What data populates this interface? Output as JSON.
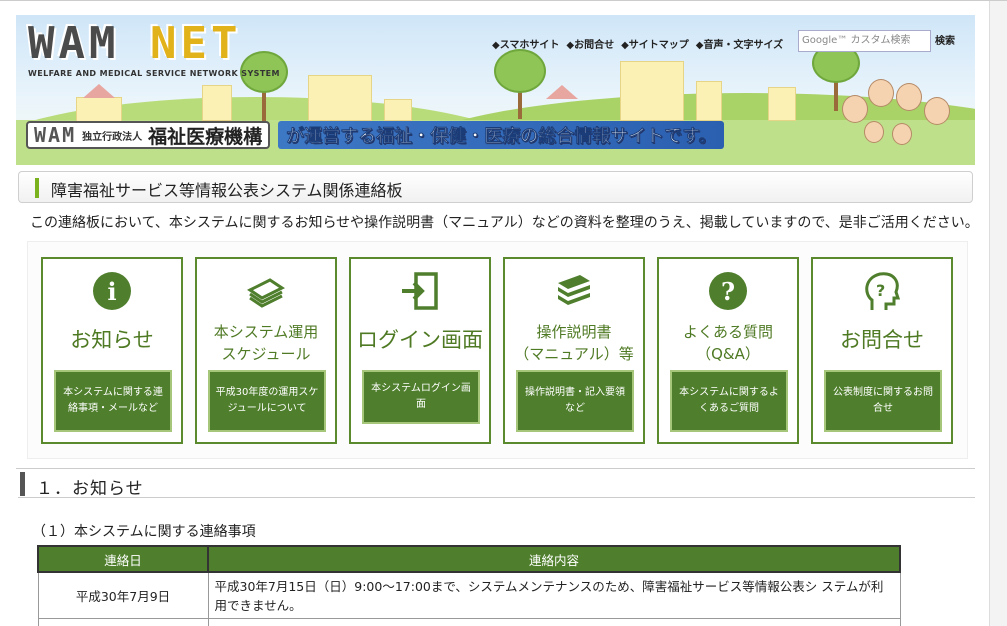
{
  "header": {
    "logo_main_a": "WAM",
    "logo_main_b": "NET",
    "logo_sub": "WELFARE AND MEDICAL SERVICE NETWORK SYSTEM",
    "links": [
      "◆スマホサイト",
      "◆お問合せ",
      "◆サイトマップ",
      "◆音声・文字サイズ"
    ],
    "search_placeholder": "Google™ カスタム検索",
    "search_button": "検索",
    "banner_logo": "WAM",
    "banner_corp": "独立行政法人",
    "banner_org": "福祉医療機構",
    "banner_text": "が運営する福祉・保健・医療の総合情報サイトです。"
  },
  "page": {
    "title": "障害福祉サービス等情報公表システム関係連絡板",
    "intro": "この連絡板において、本システムに関するお知らせや操作説明書（マニュアル）などの資料を整理のうえ、掲載していますので、是非ご活用ください。"
  },
  "tiles": [
    {
      "title": "お知らせ",
      "button": "本システムに関する連絡事項・メールなど",
      "icon": "info-icon"
    },
    {
      "title_l1": "本システム運用",
      "title_l2": "スケジュール",
      "button": "平成30年度の運用スケジュールについて",
      "icon": "calendar-icon"
    },
    {
      "title": "ログイン画面",
      "button": "本システムログイン画面",
      "icon": "login-door-icon"
    },
    {
      "title_l1": "操作説明書",
      "title_l2": "（マニュアル）等",
      "button": "操作説明書・記入要領など",
      "icon": "books-icon"
    },
    {
      "title_l1": "よくある質問",
      "title_l2": "（Q&A）",
      "button": "本システムに関するよくあるご質問",
      "icon": "question-icon"
    },
    {
      "title": "お問合せ",
      "button": "公表制度に関するお問合せ",
      "icon": "inquiry-head-icon"
    }
  ],
  "section": {
    "heading": "１．お知らせ",
    "subheading": "（１）本システムに関する連絡事項",
    "table": {
      "headers": [
        "連絡日",
        "連絡内容"
      ],
      "rows": [
        {
          "date": "平成30年7月9日",
          "content": "平成30年7月15日（日）9:00～17:00まで、システムメンテナンスのため、障害福祉サービス等情報公表シ ステムが利用できません。"
        }
      ]
    }
  },
  "colors": {
    "accent_green": "#4f7f2d",
    "header_sky": "#cfe6f8"
  }
}
